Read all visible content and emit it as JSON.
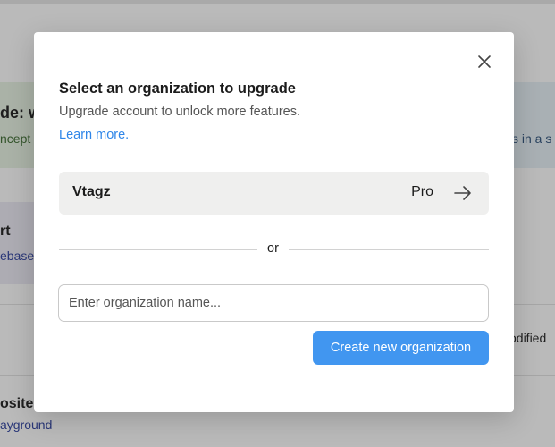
{
  "background": {
    "card_green": {
      "title": "de: w",
      "subtitle": "ncept"
    },
    "card_blue": {
      "subtitle": "s in a s"
    },
    "card_purple": {
      "title": "rt",
      "subtitle": "ebase"
    },
    "right_text": "odified",
    "bottom": {
      "title": "osite i",
      "link": "ayground"
    }
  },
  "modal": {
    "close_icon": "close-icon",
    "title": "Select an organization to upgrade",
    "subtitle": "Upgrade account to unlock more features.",
    "learn_more": "Learn more.",
    "organizations": [
      {
        "name": "Vtagz",
        "plan": "Pro",
        "icon": "arrow-right-icon"
      }
    ],
    "divider_text": "or",
    "input": {
      "value": "",
      "placeholder": "Enter organization name..."
    },
    "create_button": "Create new organization"
  },
  "colors": {
    "accent": "#4196f0",
    "link": "#2f86e8",
    "overlay": "rgba(40,40,40,0.32)"
  }
}
